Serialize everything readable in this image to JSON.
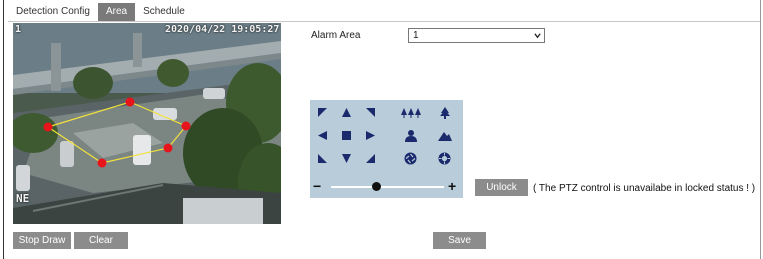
{
  "tabs": [
    {
      "label": "Detection Config",
      "active": false
    },
    {
      "label": "Area",
      "active": true
    },
    {
      "label": "Schedule",
      "active": false
    }
  ],
  "video": {
    "channel": "1",
    "timestamp": "2020/04/22 19:05:27",
    "compass": "NE"
  },
  "buttons": {
    "stop_draw": "Stop Draw",
    "clear": "Clear",
    "save": "Save",
    "unlock": "Unlock"
  },
  "alarm_area": {
    "label": "Alarm Area",
    "value": "1"
  },
  "ptz": {
    "controls": [
      "up-left",
      "up",
      "up-right",
      "zoom-out",
      "zoom-in",
      "left",
      "stop",
      "right",
      "focus-near",
      "focus-far",
      "down-left",
      "down",
      "down-right",
      "iris-close",
      "iris-open"
    ],
    "speed_minus": "−",
    "speed_plus": "+",
    "speed_fraction": 0.4
  },
  "lock_note": "( The PTZ control is unavailabe in locked status ! )",
  "colors": {
    "tab_active": "#7a7a7a",
    "button": "#8c8c8c",
    "ptz_panel": "#b8ccd9",
    "region_line": "#f2e23a",
    "region_point": "#e8141c"
  }
}
